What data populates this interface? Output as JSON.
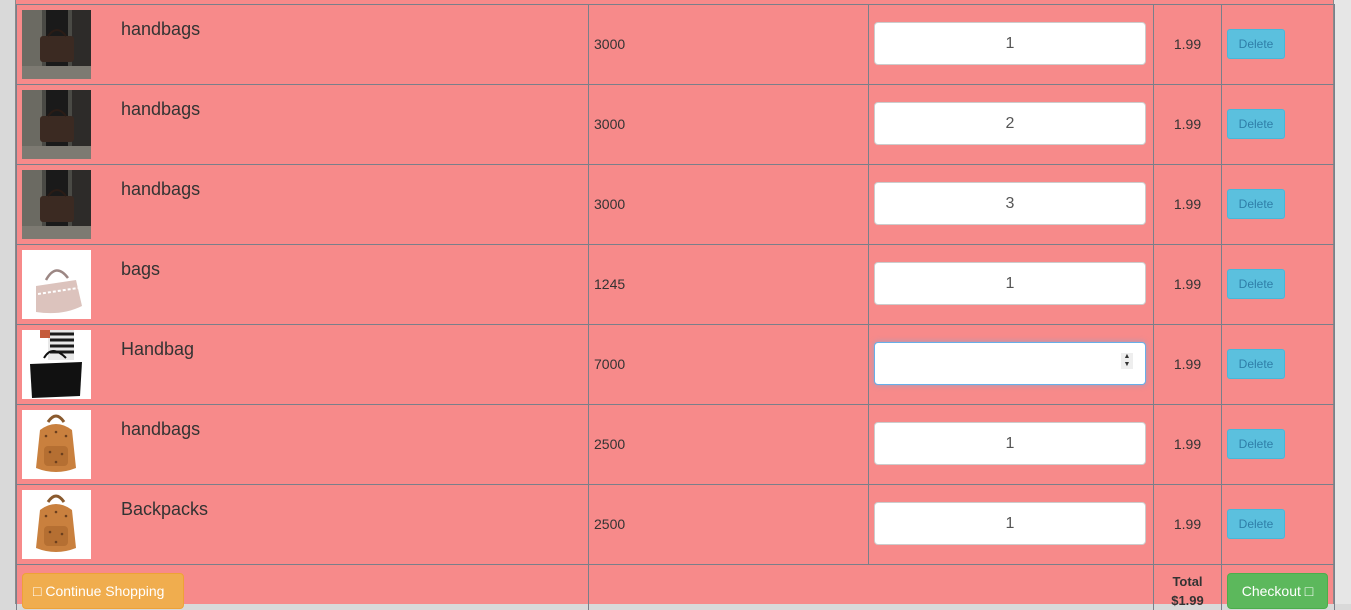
{
  "cart": {
    "items": [
      {
        "name": "handbags",
        "price": "3000",
        "quantity": "1",
        "subtotal": "1.99",
        "delete_label": "Delete",
        "image": "woman-holding-brown-handbag"
      },
      {
        "name": "handbags",
        "price": "3000",
        "quantity": "2",
        "subtotal": "1.99",
        "delete_label": "Delete",
        "image": "woman-holding-brown-handbag"
      },
      {
        "name": "handbags",
        "price": "3000",
        "quantity": "3",
        "subtotal": "1.99",
        "delete_label": "Delete",
        "image": "woman-holding-brown-handbag"
      },
      {
        "name": "bags",
        "price": "1245",
        "quantity": "1",
        "subtotal": "1.99",
        "delete_label": "Delete",
        "image": "pink-studded-handbag"
      },
      {
        "name": "Handbag",
        "price": "7000",
        "quantity": "",
        "subtotal": "1.99",
        "delete_label": "Delete",
        "image": "black-tote-bag"
      },
      {
        "name": "handbags",
        "price": "2500",
        "quantity": "1",
        "subtotal": "1.99",
        "delete_label": "Delete",
        "image": "cognac-backpack"
      },
      {
        "name": "Backpacks",
        "price": "2500",
        "quantity": "1",
        "subtotal": "1.99",
        "delete_label": "Delete",
        "image": "cognac-backpack"
      }
    ],
    "footer": {
      "continue_label": "□ Continue Shopping",
      "total_label": "Total",
      "total_value": "$1.99",
      "checkout_label": "Checkout □"
    }
  },
  "colors": {
    "row_bg": "#f78a8a",
    "delete_button": "#5bc0de",
    "continue_button": "#f0ad4e",
    "checkout_button": "#5cb85c"
  }
}
